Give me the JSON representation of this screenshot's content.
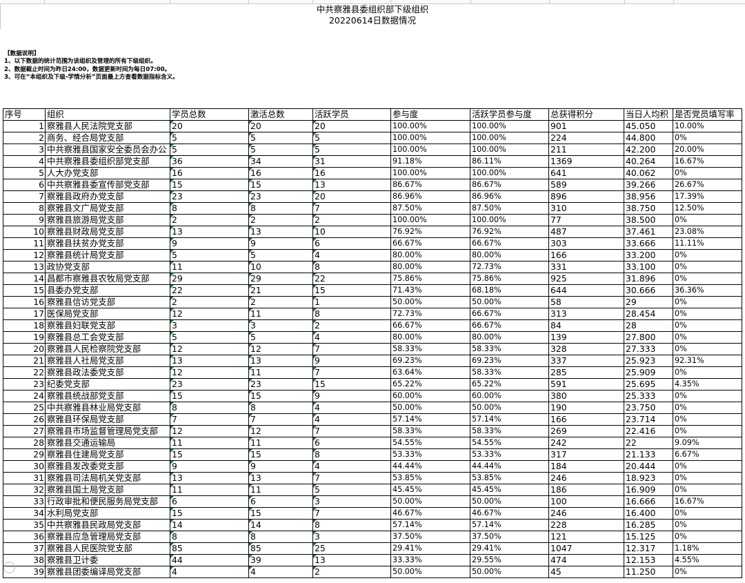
{
  "sheet": {
    "title": "中共察雅县委组织部下级组织",
    "subtitle": "20220614日数据情况"
  },
  "notes": {
    "heading": "【数据说明】",
    "lines": [
      "1、以下数据的统计范围为该组织及管理的所有下级组织。",
      "2、数据截止时间为昨日24:00，数据更新时间为每日07:00。",
      "3、可在“本组织及下级-学情分析”页面最上方查看数据指标含义。"
    ]
  },
  "table": {
    "headers": [
      "序号",
      "组织",
      "学员总数",
      "激活总数",
      "活跃学员",
      "参与度",
      "活跃学员参与度",
      "总获得积分",
      "当日人均积",
      "是否党员填写率"
    ],
    "rows": [
      [
        "1",
        "察雅县人民法院党支部",
        "20",
        "20",
        "20",
        "100.00%",
        "100.00%",
        "901",
        "45.050",
        "10.00%"
      ],
      [
        "2",
        "商务、经合局党支部",
        "5",
        "5",
        "5",
        "100.00%",
        "100.00%",
        "224",
        "44.800",
        "0%"
      ],
      [
        "3",
        "中共察雅县国家安全委员会办公",
        "5",
        "5",
        "5",
        "100.00%",
        "100.00%",
        "211",
        "42.200",
        "20.00%"
      ],
      [
        "4",
        "中共察雅县委组织部党支部",
        "36",
        "34",
        "31",
        "91.18%",
        "86.11%",
        "1369",
        "40.264",
        "16.67%"
      ],
      [
        "5",
        "人大办党支部",
        "16",
        "16",
        "16",
        "100.00%",
        "100.00%",
        "641",
        "40.062",
        "0%"
      ],
      [
        "6",
        "中共察雅县委宣传部党支部",
        "15",
        "15",
        "13",
        "86.67%",
        "86.67%",
        "589",
        "39.266",
        "26.67%"
      ],
      [
        "7",
        "察雅县政府办党支部",
        "23",
        "23",
        "20",
        "86.96%",
        "86.96%",
        "896",
        "38.956",
        "17.39%"
      ],
      [
        "8",
        "察雅县文广局党支部",
        "8",
        "8",
        "7",
        "87.50%",
        "87.50%",
        "310",
        "38.750",
        "12.50%"
      ],
      [
        "9",
        "察雅县旅游局党支部",
        "2",
        "2",
        "2",
        "100.00%",
        "100.00%",
        "77",
        "38.500",
        "0%"
      ],
      [
        "10",
        "察雅县财政局党支部",
        "13",
        "13",
        "10",
        "76.92%",
        "76.92%",
        "487",
        "37.461",
        "23.08%"
      ],
      [
        "11",
        "察雅县扶贫办党支部",
        "9",
        "9",
        "6",
        "66.67%",
        "66.67%",
        "303",
        "33.666",
        "11.11%"
      ],
      [
        "12",
        "察雅县统计局党支部",
        "5",
        "5",
        "4",
        "80.00%",
        "80.00%",
        "166",
        "33.200",
        "0%"
      ],
      [
        "13",
        "政协党支部",
        "11",
        "10",
        "8",
        "80.00%",
        "72.73%",
        "331",
        "33.100",
        "0%"
      ],
      [
        "14",
        "昌都市察雅县农牧局党支部",
        "29",
        "29",
        "22",
        "75.86%",
        "75.86%",
        "925",
        "31.896",
        "0%"
      ],
      [
        "15",
        "县委办党支部",
        "22",
        "21",
        "15",
        "71.43%",
        "68.18%",
        "644",
        "30.666",
        "36.36%"
      ],
      [
        "16",
        "察雅县信访党支部",
        "2",
        "2",
        "1",
        "50.00%",
        "50.00%",
        "58",
        "29",
        "0%"
      ],
      [
        "17",
        "医保局党支部",
        "12",
        "11",
        "8",
        "72.73%",
        "66.67%",
        "313",
        "28.454",
        "0%"
      ],
      [
        "18",
        "察雅县妇联党支部",
        "3",
        "3",
        "2",
        "66.67%",
        "66.67%",
        "84",
        "28",
        "0%"
      ],
      [
        "19",
        "察雅县总工会党支部",
        "5",
        "5",
        "4",
        "80.00%",
        "80.00%",
        "139",
        "27.800",
        "0%"
      ],
      [
        "20",
        "察雅县人民检察院党支部",
        "12",
        "12",
        "7",
        "58.33%",
        "58.33%",
        "328",
        "27.333",
        "0%"
      ],
      [
        "21",
        "察雅县人社局党支部",
        "13",
        "13",
        "9",
        "69.23%",
        "69.23%",
        "337",
        "25.923",
        "92.31%"
      ],
      [
        "22",
        "察雅县政法委党支部",
        "12",
        "11",
        "7",
        "63.64%",
        "58.33%",
        "285",
        "25.909",
        "0%"
      ],
      [
        "23",
        "纪委党支部",
        "23",
        "23",
        "15",
        "65.22%",
        "65.22%",
        "591",
        "25.695",
        "4.35%"
      ],
      [
        "24",
        "察雅县统战部党支部",
        "15",
        "15",
        "9",
        "60.00%",
        "60.00%",
        "380",
        "25.333",
        "0%"
      ],
      [
        "25",
        "中共察雅县林业局党支部",
        "8",
        "8",
        "4",
        "50.00%",
        "50.00%",
        "190",
        "23.750",
        "0%"
      ],
      [
        "26",
        "察雅县环保局党支部",
        "7",
        "7",
        "4",
        "57.14%",
        "57.14%",
        "166",
        "23.714",
        "0%"
      ],
      [
        "27",
        "察雅县市场监督管理局党支部",
        "12",
        "12",
        "7",
        "58.33%",
        "58.33%",
        "269",
        "22.416",
        "0%"
      ],
      [
        "28",
        "察雅县交通运输局",
        "11",
        "11",
        "6",
        "54.55%",
        "54.55%",
        "242",
        "22",
        "9.09%"
      ],
      [
        "29",
        "察雅县住建局党支部",
        "15",
        "15",
        "8",
        "53.33%",
        "53.33%",
        "317",
        "21.133",
        "6.67%"
      ],
      [
        "30",
        "察雅县发改委党支部",
        "9",
        "9",
        "4",
        "44.44%",
        "44.44%",
        "184",
        "20.444",
        "0%"
      ],
      [
        "31",
        "察雅县司法局机关党支部",
        "13",
        "13",
        "7",
        "53.85%",
        "53.85%",
        "246",
        "18.923",
        "0%"
      ],
      [
        "32",
        "察雅县国土局党支部",
        "11",
        "11",
        "5",
        "45.45%",
        "45.45%",
        "186",
        "16.909",
        "0%"
      ],
      [
        "33",
        "行政审批和便民服务局党支部",
        "6",
        "6",
        "3",
        "50.00%",
        "50.00%",
        "100",
        "16.666",
        "16.67%"
      ],
      [
        "34",
        "水利局党支部",
        "15",
        "15",
        "7",
        "46.67%",
        "46.67%",
        "246",
        "16.400",
        "0%"
      ],
      [
        "35",
        "中共察雅县民政局党支部",
        "14",
        "14",
        "8",
        "57.14%",
        "57.14%",
        "228",
        "16.285",
        "0%"
      ],
      [
        "36",
        "察雅县应急管理局党支部",
        "8",
        "8",
        "3",
        "37.50%",
        "37.50%",
        "121",
        "15.125",
        "0%"
      ],
      [
        "37",
        "察雅县人民医院党支部",
        "85",
        "85",
        "25",
        "29.41%",
        "29.41%",
        "1047",
        "12.317",
        "1.18%"
      ],
      [
        "38",
        "察雅县卫计委",
        "44",
        "39",
        "13",
        "33.33%",
        "29.55%",
        "474",
        "12.153",
        "4.55%"
      ],
      [
        "39",
        "察雅县团委编译局党支部",
        "4",
        "4",
        "2",
        "50.00%",
        "50.00%",
        "45",
        "11.250",
        "0%"
      ]
    ]
  }
}
